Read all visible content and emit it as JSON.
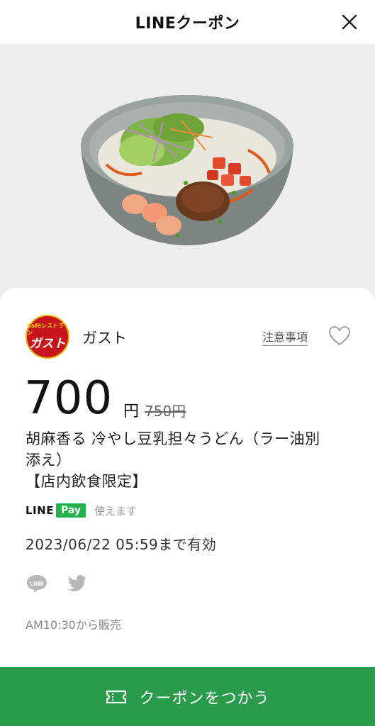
{
  "header": {
    "title": "LINEクーポン"
  },
  "brand": {
    "name": "ガスト",
    "logo_top": "Caféレストラン",
    "logo_main": "ガスト",
    "logo_color": "#c8151d"
  },
  "notes_link": "注意事項",
  "price": {
    "value": "700",
    "unit": "円",
    "original": "750円"
  },
  "title": {
    "line1": "胡麻香る 冷やし豆乳担々うどん（ラー油別",
    "line2": "添え）",
    "line3": "【店内飲食限定】"
  },
  "pay": {
    "line_label": "LINE",
    "pay_label": "Pay",
    "note": "使えます",
    "badge_color": "#22b14c"
  },
  "validity": "2023/06/22 05:59まで有効",
  "share": {
    "icons": [
      "line-icon",
      "twitter-icon"
    ]
  },
  "sale_time": "AM10:30から販売",
  "use_button": {
    "label": "クーポンをつかう",
    "color": "#2a9a4b"
  }
}
